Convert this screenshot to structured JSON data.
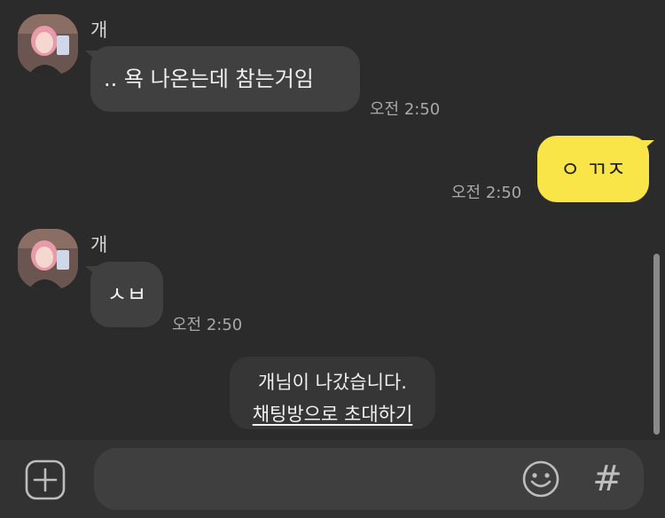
{
  "messages": [
    {
      "sender": "개",
      "text": ".. 욕 나온는데 참는거임",
      "time": "오전 2:50",
      "direction": "in"
    },
    {
      "text": "ㅇ ㄲㅈ",
      "time": "오전 2:50",
      "direction": "out"
    },
    {
      "sender": "개",
      "text": "ㅅㅂ",
      "time": "오전 2:50",
      "direction": "in"
    }
  ],
  "notice": {
    "text": "개님이 나갔습니다.",
    "invite_link": "채팅방으로 초대하기"
  },
  "input": {
    "value": "",
    "placeholder": ""
  },
  "bottom_bar": {
    "hash_label": "#"
  },
  "colors": {
    "background": "#2b2b2b",
    "incoming_bubble": "#404040",
    "outgoing_bubble": "#f9e547",
    "input_bar": "#323232"
  },
  "icons": {
    "attach": "plus-square-icon",
    "emoji": "smiley-icon",
    "hash": "hash-icon"
  }
}
